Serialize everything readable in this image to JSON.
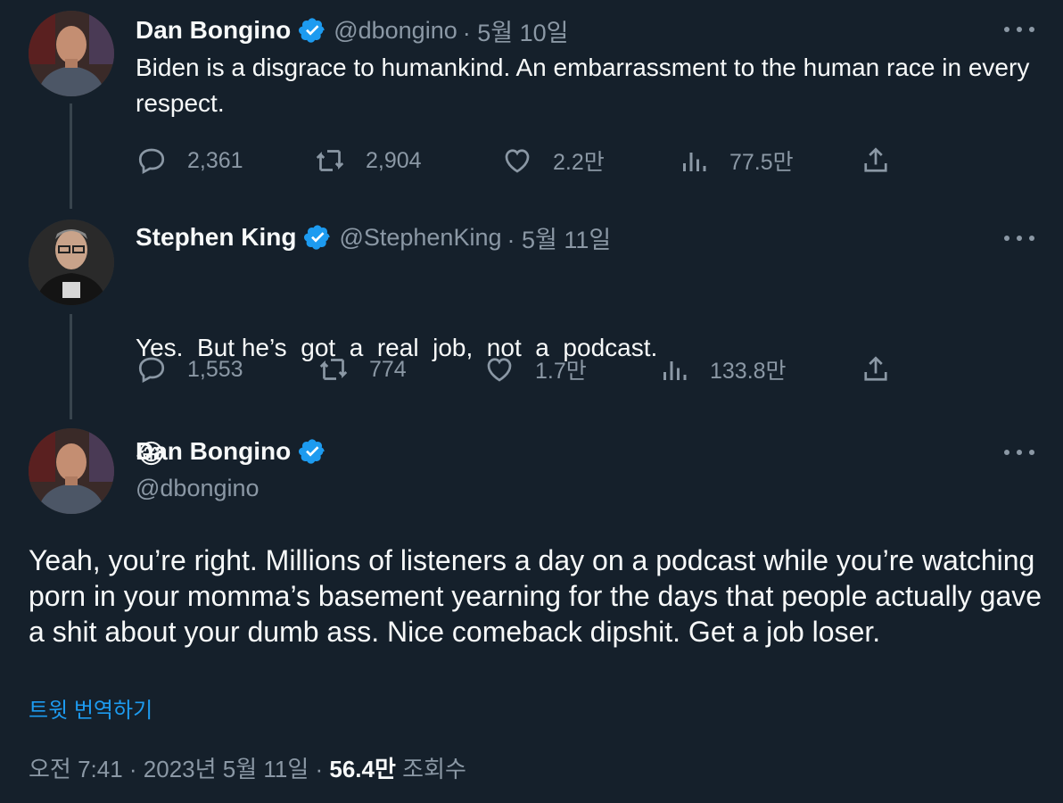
{
  "tweets": [
    {
      "name": "Dan Bongino",
      "handle": "@dbongino",
      "date": "· 5월 10일",
      "text": "Biden is a disgrace to humankind. An embarrassment to the human race in every respect.",
      "replies": "2,361",
      "retweets": "2,904",
      "likes": "2.2만",
      "views": "77.5만"
    },
    {
      "name": "Stephen King",
      "handle": "@StephenKing",
      "date": "· 5월 11일",
      "text": "Yes.  But he’s  got  a  real  job,  not  a  podcast.",
      "emoji": "😂",
      "replies": "1,553",
      "retweets": "774",
      "likes": "1.7만",
      "views": "133.8만"
    }
  ],
  "main": {
    "name": "Dan Bongino",
    "handle": "@dbongino",
    "text": "Yeah, you’re right. Millions of listeners a day on a podcast while you’re watching porn in your momma’s basement yearning for the days that people actually gave a shit about your dumb ass. Nice comeback dipshit. Get a job loser.",
    "translate": "트윗 번역하기",
    "time": "오전 7:41 · 2023년 5월 11일 ·",
    "views_count": "56.4만",
    "views_label": "조회수"
  },
  "colors": {
    "background": "#15202b",
    "text": "#f7f9f9",
    "secondary": "#8b98a5",
    "accent": "#1d9bf0",
    "thread_line": "#38444d"
  },
  "icons": [
    "verified-badge-icon",
    "more-icon",
    "reply-icon",
    "retweet-icon",
    "like-icon",
    "views-icon",
    "share-icon"
  ]
}
